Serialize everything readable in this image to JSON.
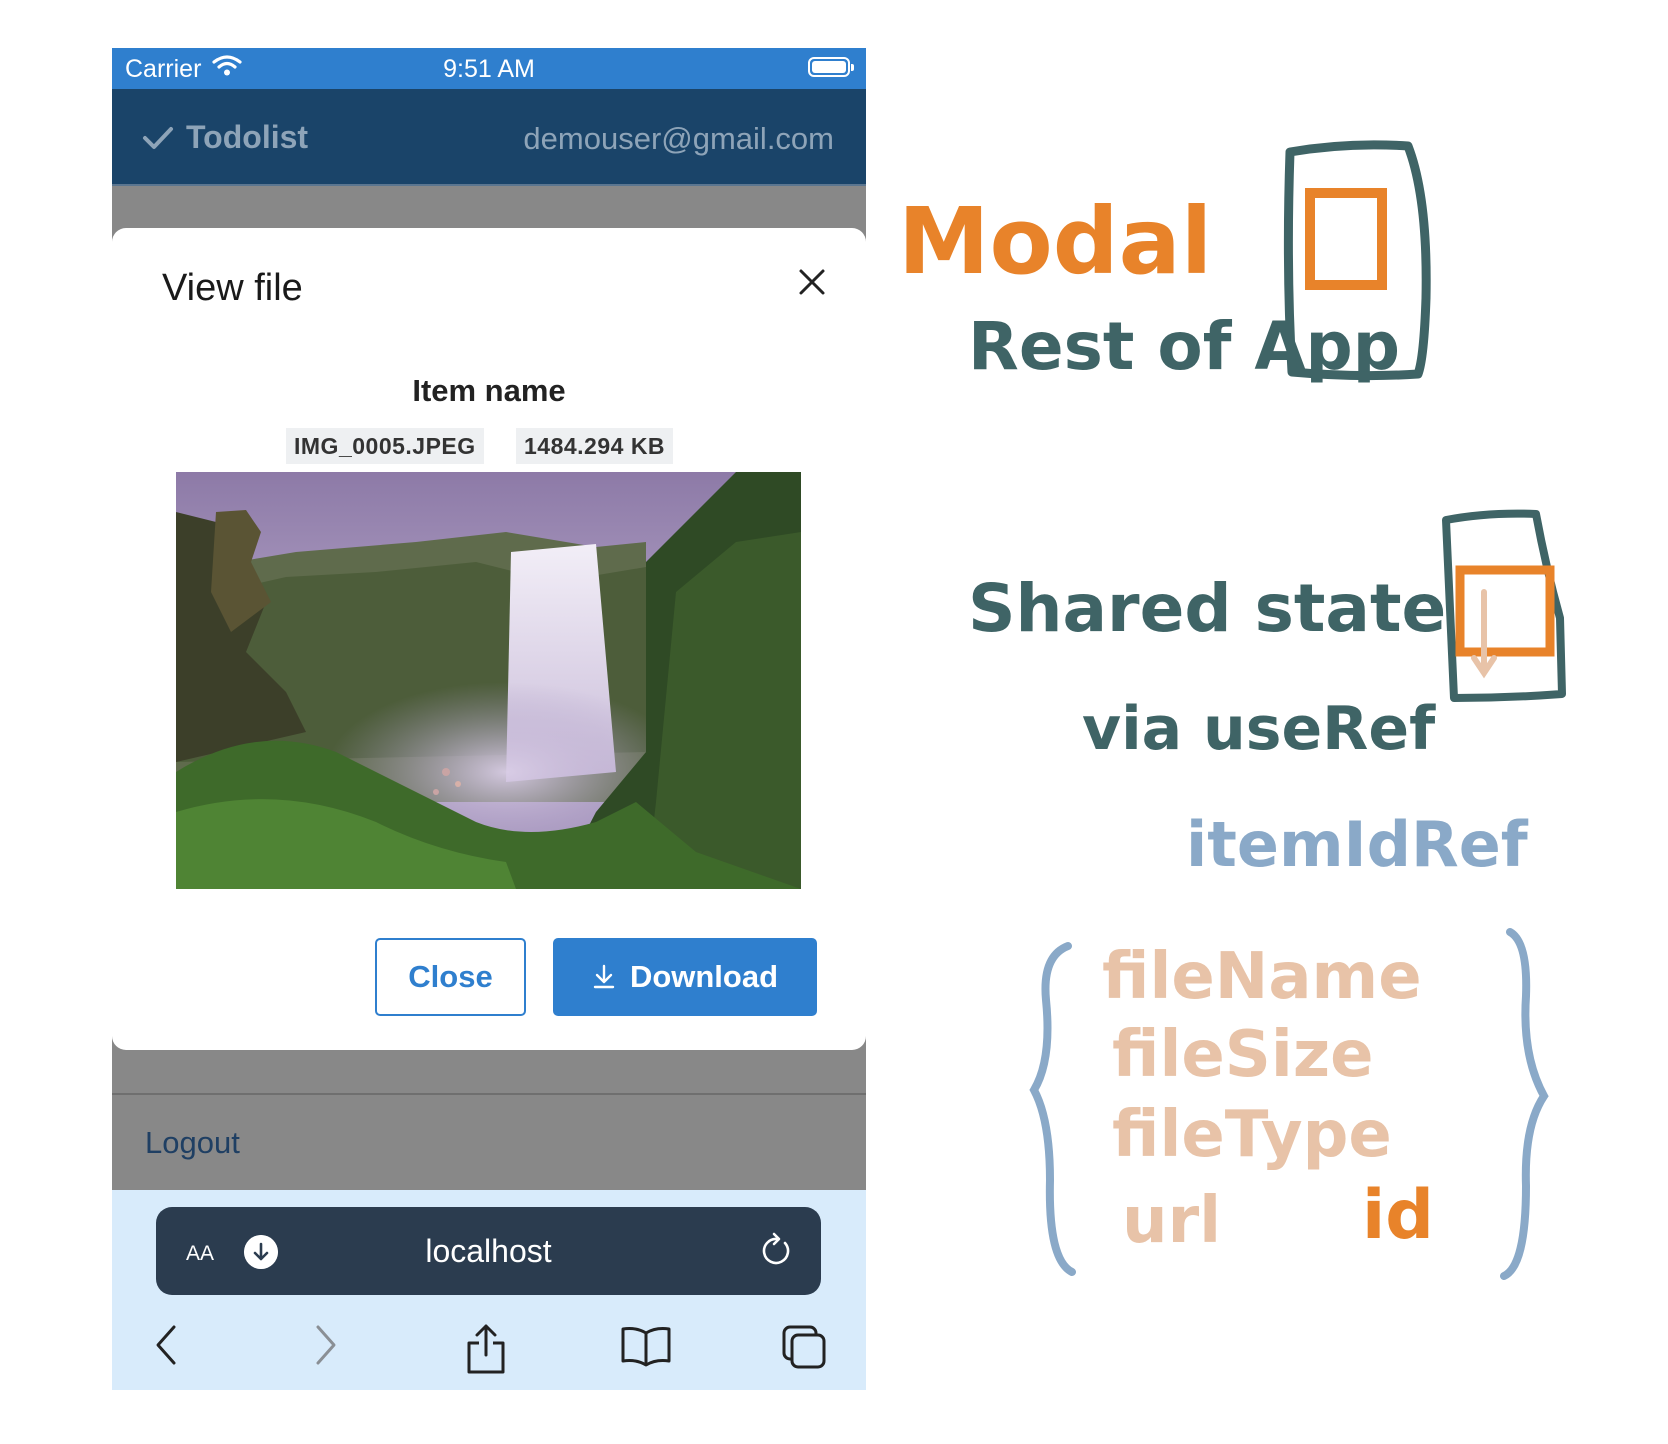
{
  "status_bar": {
    "carrier": "Carrier",
    "time": "9:51 AM"
  },
  "app_bar": {
    "title": "Todolist",
    "user_email": "demouser@gmail.com"
  },
  "modal": {
    "title": "View file",
    "item_name": "Item name",
    "file_name": "IMG_0005.JPEG",
    "file_size": "1484.294 KB",
    "close_button": "Close",
    "download_button": "Download"
  },
  "menu": {
    "logout": "Logout"
  },
  "browser": {
    "text_size_label": "AA",
    "url": "localhost"
  },
  "annotations": {
    "modal_label": "Modal",
    "rest_label": "Rest of App",
    "shared_state": "Shared state",
    "via_useref": "via useRef",
    "ref_name": "itemIdRef",
    "fields": [
      "fileName",
      "fileSize",
      "fileType",
      "url"
    ],
    "id_label": "id"
  },
  "colors": {
    "status_bar": "#2f7fce",
    "app_bar": "#1a4469",
    "primary": "#2f7fce",
    "overlay": "#888888",
    "browser_bar": "#d8ebfb",
    "note_orange": "#e8832a",
    "note_teal": "#3f6466",
    "note_blue": "#8aa9c8",
    "note_peach": "#e8c3a8"
  }
}
